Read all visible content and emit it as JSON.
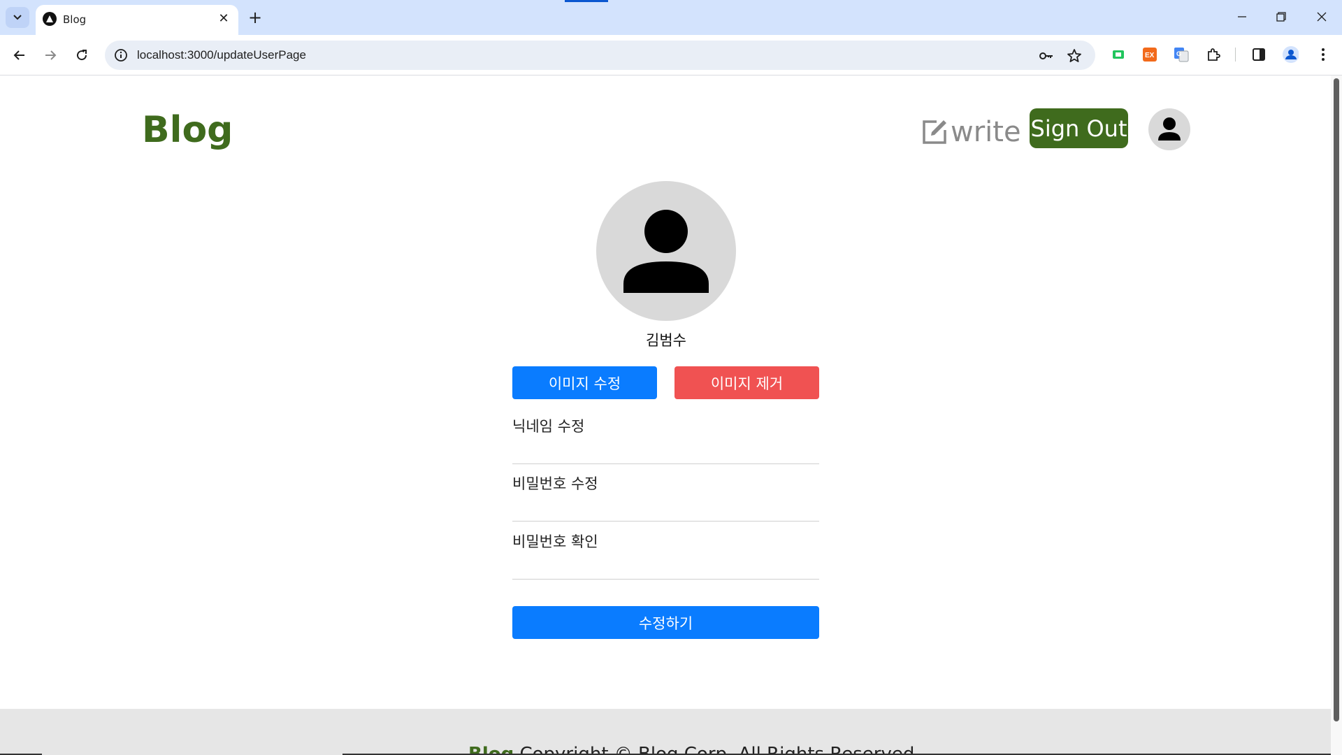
{
  "browser": {
    "tab_title": "Blog",
    "url": "localhost:3000/updateUserPage"
  },
  "header": {
    "logo": "Blog",
    "write_label": "write",
    "signout_label": "Sign Out"
  },
  "profile": {
    "username": "김범수",
    "edit_image_label": "이미지 수정",
    "remove_image_label": "이미지 제거"
  },
  "form": {
    "nickname_label": "닉네임 수정",
    "password_label": "비밀번호 수정",
    "password_confirm_label": "비밀번호 확인",
    "nickname_value": "",
    "password_value": "",
    "password_confirm_value": "",
    "submit_label": "수정하기"
  },
  "footer": {
    "brand": "Blog",
    "copyright": " Copyright © Blog Corp. All Rights Reserved"
  },
  "colors": {
    "brand_green": "#3f6b1d",
    "primary_blue": "#0a7cff",
    "danger_red": "#f05252"
  }
}
